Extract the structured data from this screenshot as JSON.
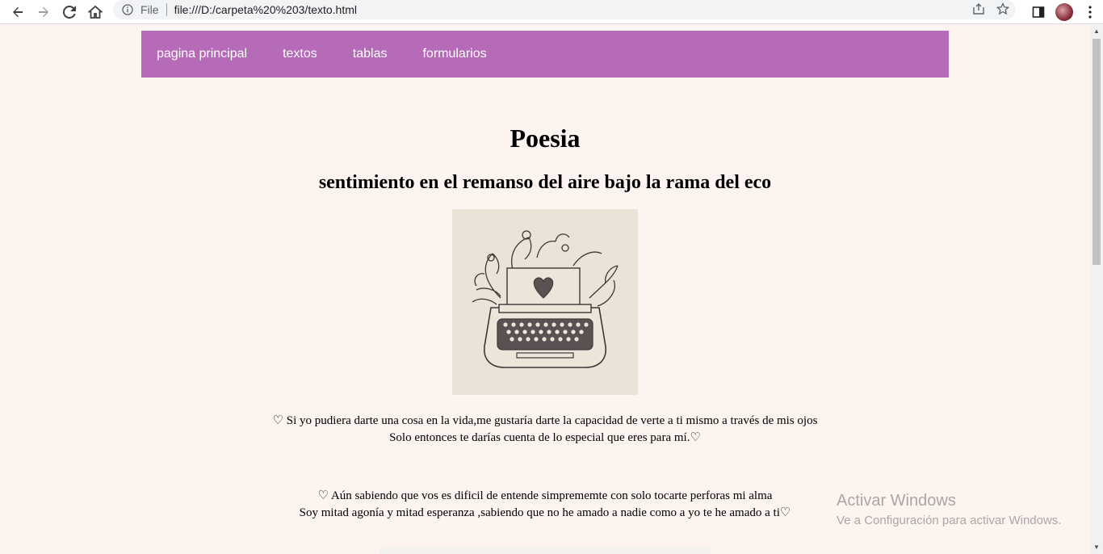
{
  "browser": {
    "scheme_label": "File",
    "url": "file:///D:/carpeta%20%203/texto.html"
  },
  "nav": {
    "items": [
      {
        "label": "pagina principal"
      },
      {
        "label": "textos"
      },
      {
        "label": "tablas"
      },
      {
        "label": "formularios"
      }
    ]
  },
  "content": {
    "title": "Poesia",
    "subtitle": "sentimiento en el remanso del aire bajo la rama del eco",
    "image_icon": "typewriter-heart-illustration",
    "paragraphs": [
      {
        "line1": "♡ Si yo pudiera darte una cosa en la vida,me gustaría darte la capacidad de verte a ti mismo a través de mis ojos",
        "line2": "Solo entonces te darías cuenta de lo especial que eres para mí.♡"
      },
      {
        "line1": "♡ Aún sabiendo que vos es dificil de entende simprememte con solo tocarte perforas mi alma",
        "line2": "Soy mitad agonía y mitad esperanza ,sabiendo que no he amado a nadie como a yo te he amado a ti♡"
      }
    ]
  },
  "watermark": {
    "title": "Activar Windows",
    "subtitle": "Ve a Configuración para activar Windows."
  },
  "colors": {
    "navbar": "#b56bb8",
    "page_background": "#fdf4f0"
  }
}
